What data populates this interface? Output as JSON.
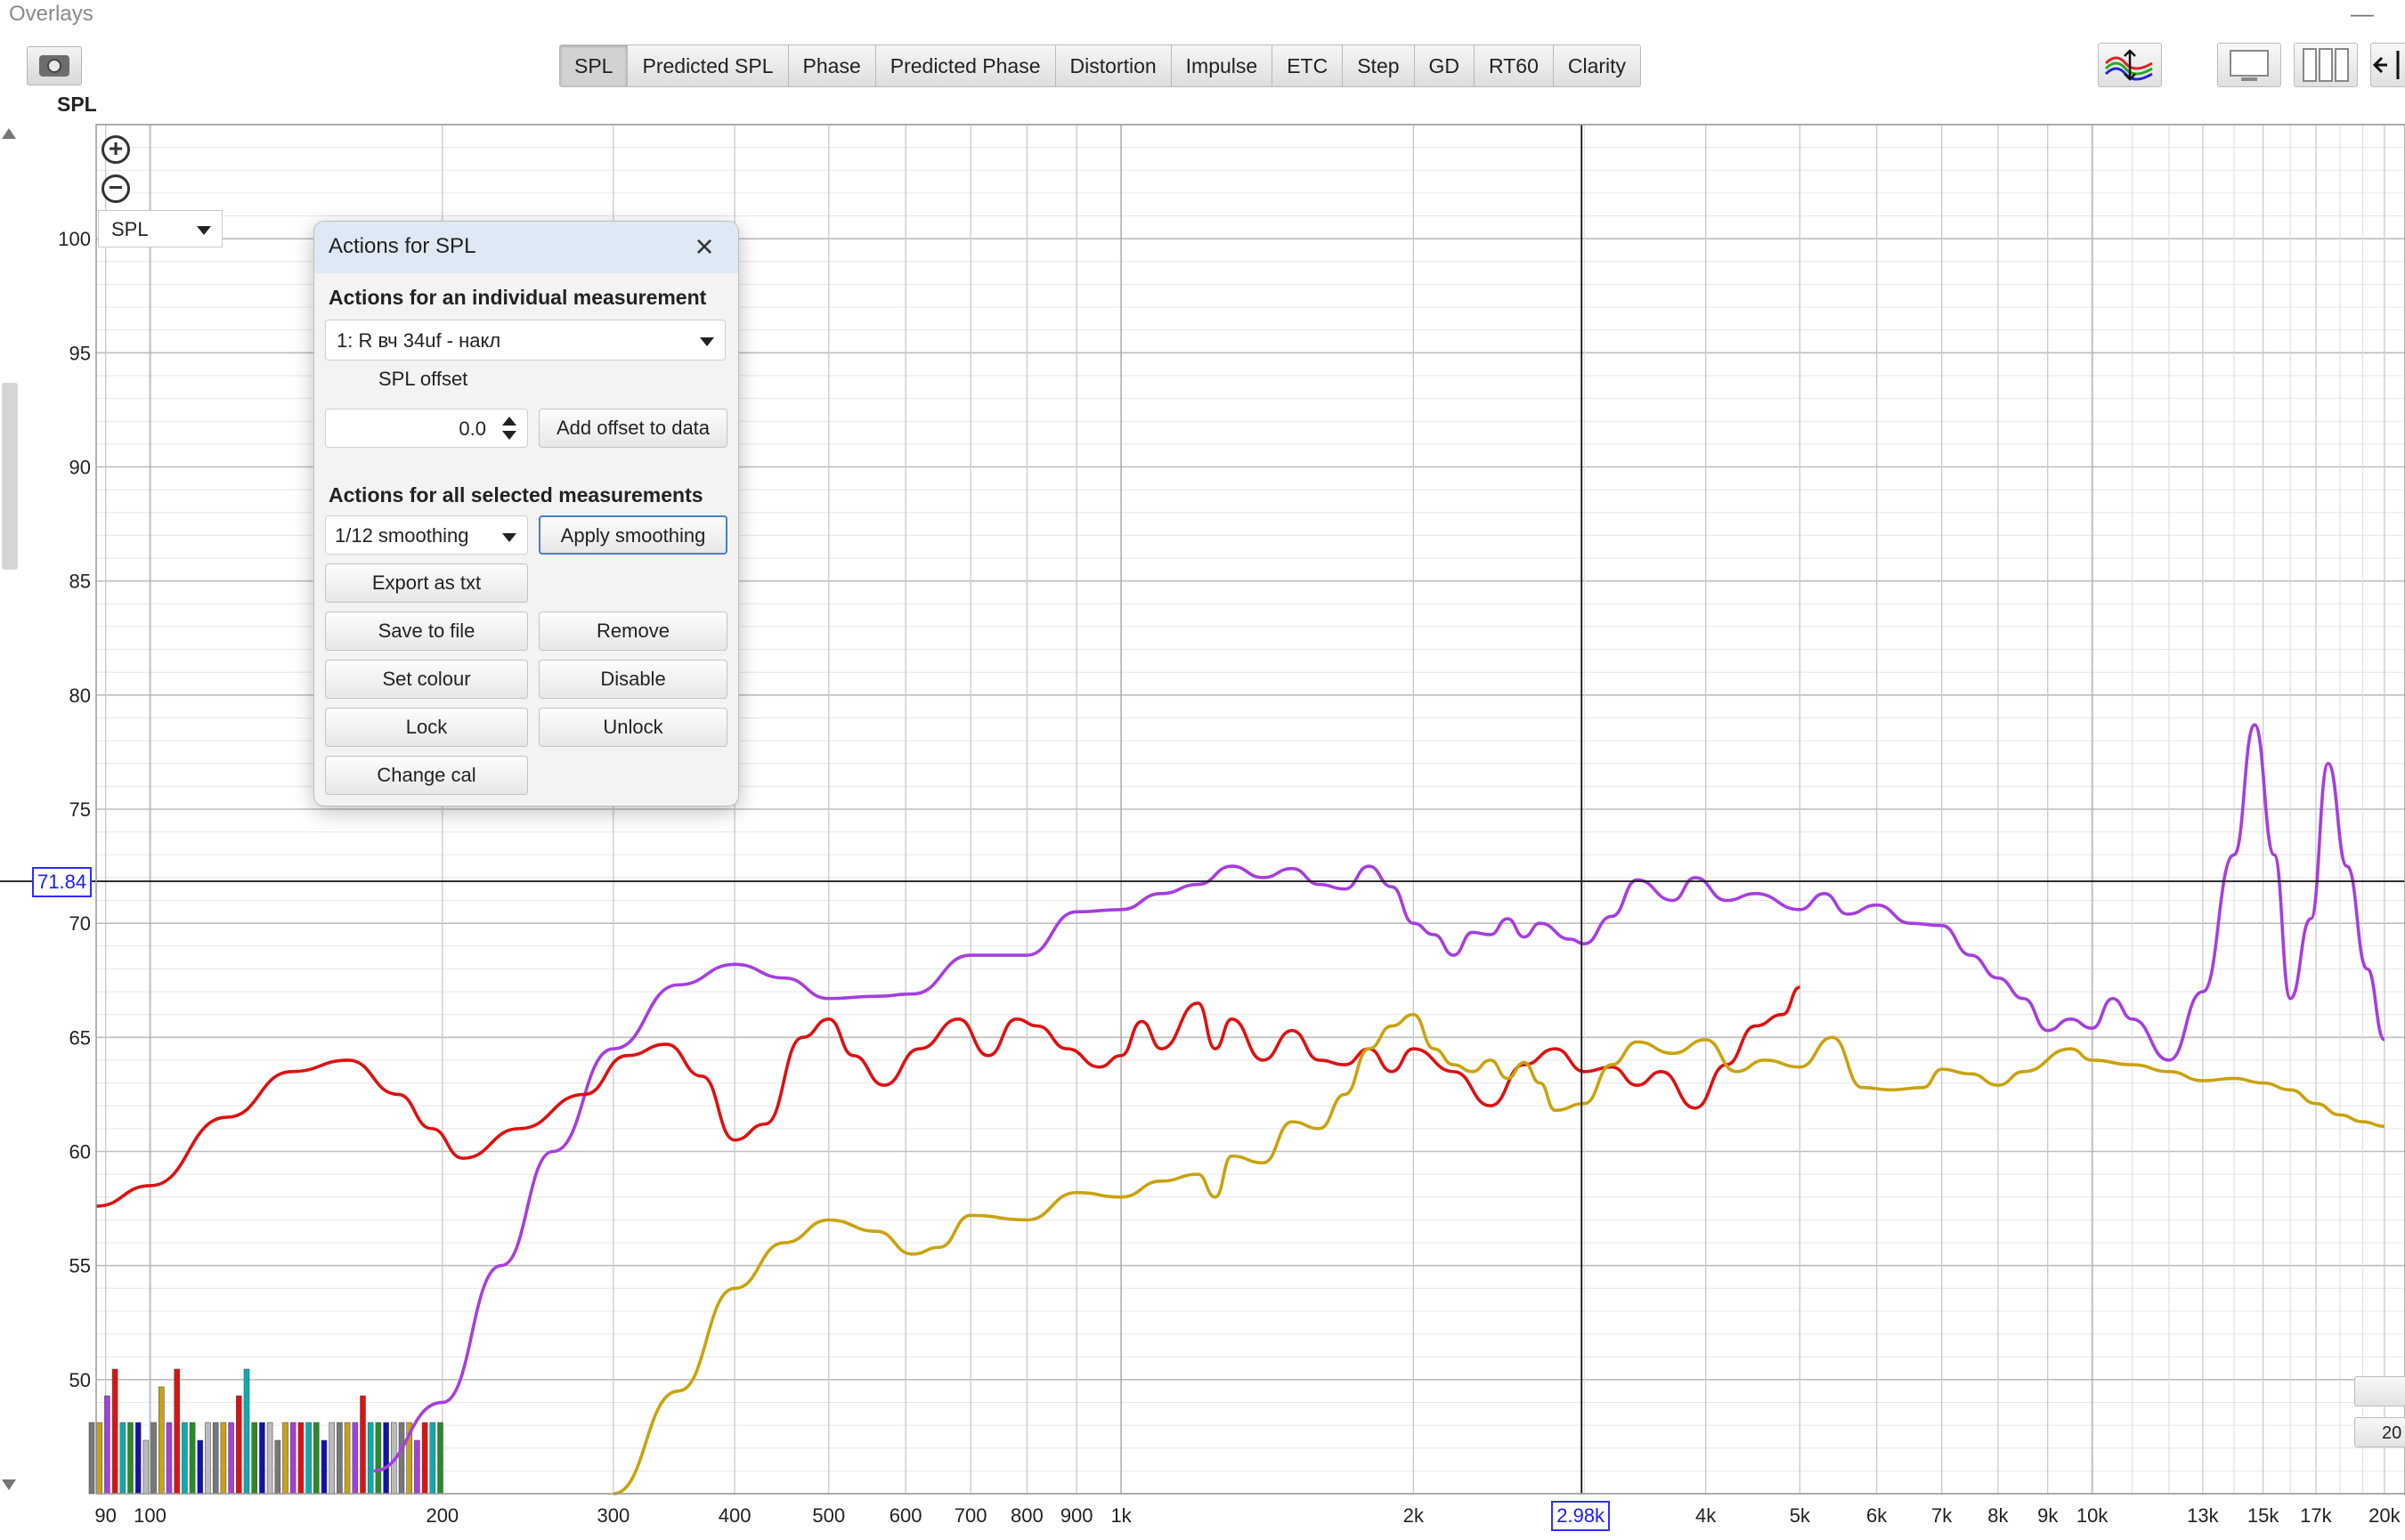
{
  "window": {
    "title": "Overlays"
  },
  "header": {
    "graph_label": "SPL"
  },
  "tabs": [
    {
      "label": "SPL",
      "active": true
    },
    {
      "label": "Predicted SPL",
      "active": false
    },
    {
      "label": "Phase",
      "active": false
    },
    {
      "label": "Predicted Phase",
      "active": false
    },
    {
      "label": "Distortion",
      "active": false
    },
    {
      "label": "Impulse",
      "active": false
    },
    {
      "label": "ETC",
      "active": false
    },
    {
      "label": "Step",
      "active": false
    },
    {
      "label": "GD",
      "active": false
    },
    {
      "label": "RT60",
      "active": false
    },
    {
      "label": "Clarity",
      "active": false
    }
  ],
  "graph": {
    "y_select": "SPL",
    "y_cursor_value": "71.84",
    "x_cursor_value": "2.98k",
    "right_buttons": [
      "",
      "20"
    ]
  },
  "dialog": {
    "title": "Actions for SPL",
    "section_individual": "Actions for an individual measurement",
    "measurement": "1: R вч 34uf - накл",
    "spl_offset_label": "SPL offset",
    "spl_offset_value": "0.0",
    "add_offset_label": "Add offset to data",
    "section_all": "Actions for all selected measurements",
    "smoothing": "1/12 smoothing",
    "apply_smoothing_label": "Apply smoothing",
    "export_label": "Export as txt",
    "save_label": "Save to file",
    "remove_label": "Remove",
    "set_colour_label": "Set colour",
    "disable_label": "Disable",
    "lock_label": "Lock",
    "unlock_label": "Unlock",
    "change_cal_label": "Change cal"
  },
  "chart_data": {
    "type": "line",
    "x_scale": "log",
    "xlim": [
      88,
      21000
    ],
    "ylim": [
      45,
      105
    ],
    "y_ticks": [
      50,
      55,
      60,
      65,
      70,
      75,
      80,
      85,
      90,
      95,
      100
    ],
    "x_ticks": [
      {
        "v": 90,
        "label": "90"
      },
      {
        "v": 100,
        "label": "100"
      },
      {
        "v": 200,
        "label": "200"
      },
      {
        "v": 300,
        "label": "300"
      },
      {
        "v": 400,
        "label": "400"
      },
      {
        "v": 500,
        "label": "500"
      },
      {
        "v": 600,
        "label": "600"
      },
      {
        "v": 700,
        "label": "700"
      },
      {
        "v": 800,
        "label": "800"
      },
      {
        "v": 900,
        "label": "900"
      },
      {
        "v": 1000,
        "label": "1k"
      },
      {
        "v": 2000,
        "label": "2k"
      },
      {
        "v": 4000,
        "label": "4k"
      },
      {
        "v": 5000,
        "label": "5k"
      },
      {
        "v": 6000,
        "label": "6k"
      },
      {
        "v": 7000,
        "label": "7k"
      },
      {
        "v": 8000,
        "label": "8k"
      },
      {
        "v": 9000,
        "label": "9k"
      },
      {
        "v": 10000,
        "label": "10k"
      },
      {
        "v": 13000,
        "label": "13k"
      },
      {
        "v": 15000,
        "label": "15k"
      },
      {
        "v": 17000,
        "label": "17k"
      },
      {
        "v": 20000,
        "label": "20k"
      }
    ],
    "cursor": {
      "x": 2980,
      "y": 71.84
    },
    "grid": true,
    "colors": {
      "purple": "#a53ede",
      "red": "#dd1111",
      "yellow": "#c9a30f"
    },
    "series": [
      {
        "color": "purple",
        "points": [
          [
            170,
            46
          ],
          [
            200,
            49
          ],
          [
            230,
            55
          ],
          [
            260,
            60
          ],
          [
            300,
            64.5
          ],
          [
            350,
            67.3
          ],
          [
            400,
            68.2
          ],
          [
            450,
            67.6
          ],
          [
            500,
            66.7
          ],
          [
            560,
            66.8
          ],
          [
            610,
            66.9
          ],
          [
            700,
            68.6
          ],
          [
            800,
            68.6
          ],
          [
            900,
            70.5
          ],
          [
            1000,
            70.6
          ],
          [
            1100,
            71.3
          ],
          [
            1200,
            71.7
          ],
          [
            1300,
            72.5
          ],
          [
            1400,
            72
          ],
          [
            1500,
            72.4
          ],
          [
            1600,
            71.7
          ],
          [
            1700,
            71.5
          ],
          [
            1800,
            72.5
          ],
          [
            1900,
            71.6
          ],
          [
            2000,
            70
          ],
          [
            2100,
            69.5
          ],
          [
            2200,
            68.6
          ],
          [
            2300,
            69.6
          ],
          [
            2400,
            69.5
          ],
          [
            2500,
            70.2
          ],
          [
            2600,
            69.4
          ],
          [
            2700,
            70
          ],
          [
            2900,
            69.3
          ],
          [
            3000,
            69.1
          ],
          [
            3200,
            70.3
          ],
          [
            3400,
            71.9
          ],
          [
            3700,
            71
          ],
          [
            3900,
            72
          ],
          [
            4200,
            71
          ],
          [
            4500,
            71.3
          ],
          [
            5000,
            70.6
          ],
          [
            5300,
            71.3
          ],
          [
            5600,
            70.4
          ],
          [
            6000,
            70.8
          ],
          [
            6500,
            70
          ],
          [
            7000,
            69.9
          ],
          [
            7500,
            68.6
          ],
          [
            8000,
            67.6
          ],
          [
            8500,
            66.7
          ],
          [
            9000,
            65.3
          ],
          [
            9500,
            65.8
          ],
          [
            10000,
            65.4
          ],
          [
            10500,
            66.7
          ],
          [
            11000,
            65.8
          ],
          [
            12000,
            64
          ],
          [
            13000,
            67
          ],
          [
            14000,
            73
          ],
          [
            14700,
            78.7
          ],
          [
            15400,
            73
          ],
          [
            16000,
            66.7
          ],
          [
            16800,
            70.2
          ],
          [
            17500,
            77
          ],
          [
            18300,
            72.5
          ],
          [
            19200,
            68
          ],
          [
            20000,
            64.9
          ]
        ]
      },
      {
        "color": "red",
        "points": [
          [
            88,
            57.6
          ],
          [
            100,
            58.5
          ],
          [
            120,
            61.5
          ],
          [
            140,
            63.5
          ],
          [
            160,
            64
          ],
          [
            180,
            62.5
          ],
          [
            195,
            61
          ],
          [
            210,
            59.7
          ],
          [
            240,
            61
          ],
          [
            280,
            62.5
          ],
          [
            310,
            64.2
          ],
          [
            340,
            64.7
          ],
          [
            370,
            63.3
          ],
          [
            400,
            60.5
          ],
          [
            430,
            61.2
          ],
          [
            470,
            65
          ],
          [
            500,
            65.8
          ],
          [
            530,
            64.2
          ],
          [
            570,
            62.9
          ],
          [
            620,
            64.5
          ],
          [
            680,
            65.8
          ],
          [
            730,
            64.2
          ],
          [
            780,
            65.8
          ],
          [
            820,
            65.5
          ],
          [
            880,
            64.5
          ],
          [
            950,
            63.7
          ],
          [
            1000,
            64.2
          ],
          [
            1050,
            65.7
          ],
          [
            1100,
            64.5
          ],
          [
            1200,
            66.5
          ],
          [
            1250,
            64.5
          ],
          [
            1300,
            65.8
          ],
          [
            1400,
            64
          ],
          [
            1500,
            65.3
          ],
          [
            1600,
            64
          ],
          [
            1700,
            63.8
          ],
          [
            1800,
            64.5
          ],
          [
            1900,
            63.5
          ],
          [
            2000,
            64.5
          ],
          [
            2200,
            63.5
          ],
          [
            2400,
            62
          ],
          [
            2600,
            63.8
          ],
          [
            2800,
            64.5
          ],
          [
            3000,
            63.5
          ],
          [
            3200,
            63.7
          ],
          [
            3400,
            62.9
          ],
          [
            3600,
            63.5
          ],
          [
            3900,
            61.9
          ],
          [
            4200,
            63.8
          ],
          [
            4500,
            65.5
          ],
          [
            4800,
            66
          ],
          [
            5000,
            67.2
          ]
        ]
      },
      {
        "color": "yellow",
        "points": [
          [
            300,
            45
          ],
          [
            350,
            49.5
          ],
          [
            400,
            54
          ],
          [
            450,
            56
          ],
          [
            500,
            57
          ],
          [
            560,
            56.5
          ],
          [
            610,
            55.5
          ],
          [
            650,
            55.8
          ],
          [
            700,
            57.2
          ],
          [
            800,
            57
          ],
          [
            900,
            58.2
          ],
          [
            1000,
            58
          ],
          [
            1100,
            58.7
          ],
          [
            1200,
            59
          ],
          [
            1250,
            58
          ],
          [
            1300,
            59.8
          ],
          [
            1400,
            59.5
          ],
          [
            1500,
            61.3
          ],
          [
            1600,
            61
          ],
          [
            1700,
            62.5
          ],
          [
            1800,
            64.5
          ],
          [
            1900,
            65.5
          ],
          [
            2000,
            66
          ],
          [
            2100,
            64.5
          ],
          [
            2200,
            63.8
          ],
          [
            2300,
            63.5
          ],
          [
            2400,
            64
          ],
          [
            2500,
            63.2
          ],
          [
            2600,
            63.9
          ],
          [
            2700,
            63
          ],
          [
            2800,
            61.8
          ],
          [
            3000,
            62.1
          ],
          [
            3200,
            63.8
          ],
          [
            3400,
            64.8
          ],
          [
            3700,
            64.3
          ],
          [
            4000,
            64.9
          ],
          [
            4300,
            63.5
          ],
          [
            4600,
            64
          ],
          [
            5000,
            63.7
          ],
          [
            5400,
            65
          ],
          [
            5800,
            62.8
          ],
          [
            6200,
            62.7
          ],
          [
            6700,
            62.8
          ],
          [
            7000,
            63.6
          ],
          [
            7500,
            63.4
          ],
          [
            8000,
            62.9
          ],
          [
            8500,
            63.5
          ],
          [
            9500,
            64.5
          ],
          [
            10000,
            64
          ],
          [
            11000,
            63.8
          ],
          [
            12000,
            63.5
          ],
          [
            13000,
            63.1
          ],
          [
            14000,
            63.2
          ],
          [
            15000,
            63
          ],
          [
            16000,
            62.7
          ],
          [
            17000,
            62.1
          ],
          [
            18000,
            61.6
          ],
          [
            19000,
            61.3
          ],
          [
            20000,
            61.1
          ]
        ]
      }
    ]
  }
}
